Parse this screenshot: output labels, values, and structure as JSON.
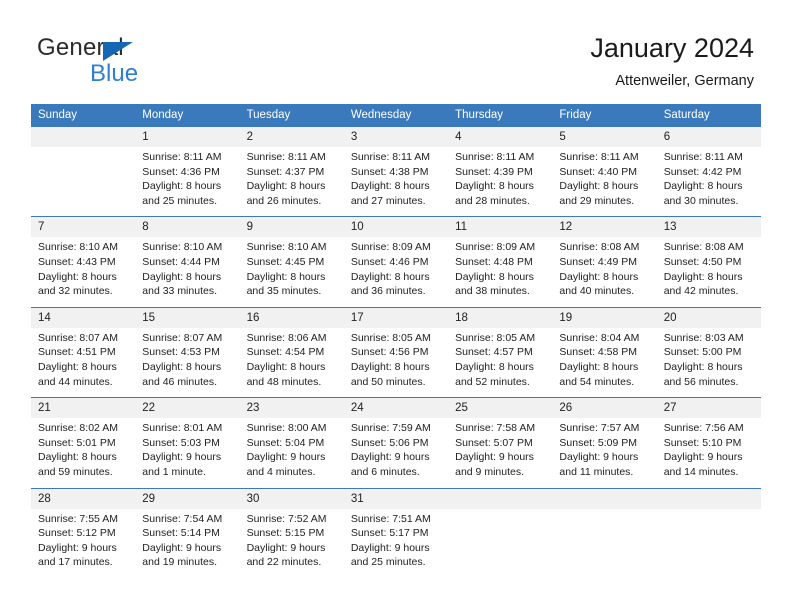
{
  "brand": {
    "name_part1": "General",
    "name_part2": "Blue",
    "accent_color": "#1567b3",
    "blue_text_color": "#2f7fd1"
  },
  "header": {
    "title": "January 2024",
    "subtitle": "Attenweiler, Germany"
  },
  "calendar": {
    "header_bg": "#3b79bd",
    "daynum_bg": "#f1f1f1",
    "weekdays": [
      "Sunday",
      "Monday",
      "Tuesday",
      "Wednesday",
      "Thursday",
      "Friday",
      "Saturday"
    ],
    "weeks": [
      [
        {
          "day": "",
          "sunrise": "",
          "sunset": "",
          "daylight": ""
        },
        {
          "day": "1",
          "sunrise": "Sunrise: 8:11 AM",
          "sunset": "Sunset: 4:36 PM",
          "daylight": "Daylight: 8 hours and 25 minutes."
        },
        {
          "day": "2",
          "sunrise": "Sunrise: 8:11 AM",
          "sunset": "Sunset: 4:37 PM",
          "daylight": "Daylight: 8 hours and 26 minutes."
        },
        {
          "day": "3",
          "sunrise": "Sunrise: 8:11 AM",
          "sunset": "Sunset: 4:38 PM",
          "daylight": "Daylight: 8 hours and 27 minutes."
        },
        {
          "day": "4",
          "sunrise": "Sunrise: 8:11 AM",
          "sunset": "Sunset: 4:39 PM",
          "daylight": "Daylight: 8 hours and 28 minutes."
        },
        {
          "day": "5",
          "sunrise": "Sunrise: 8:11 AM",
          "sunset": "Sunset: 4:40 PM",
          "daylight": "Daylight: 8 hours and 29 minutes."
        },
        {
          "day": "6",
          "sunrise": "Sunrise: 8:11 AM",
          "sunset": "Sunset: 4:42 PM",
          "daylight": "Daylight: 8 hours and 30 minutes."
        }
      ],
      [
        {
          "day": "7",
          "sunrise": "Sunrise: 8:10 AM",
          "sunset": "Sunset: 4:43 PM",
          "daylight": "Daylight: 8 hours and 32 minutes."
        },
        {
          "day": "8",
          "sunrise": "Sunrise: 8:10 AM",
          "sunset": "Sunset: 4:44 PM",
          "daylight": "Daylight: 8 hours and 33 minutes."
        },
        {
          "day": "9",
          "sunrise": "Sunrise: 8:10 AM",
          "sunset": "Sunset: 4:45 PM",
          "daylight": "Daylight: 8 hours and 35 minutes."
        },
        {
          "day": "10",
          "sunrise": "Sunrise: 8:09 AM",
          "sunset": "Sunset: 4:46 PM",
          "daylight": "Daylight: 8 hours and 36 minutes."
        },
        {
          "day": "11",
          "sunrise": "Sunrise: 8:09 AM",
          "sunset": "Sunset: 4:48 PM",
          "daylight": "Daylight: 8 hours and 38 minutes."
        },
        {
          "day": "12",
          "sunrise": "Sunrise: 8:08 AM",
          "sunset": "Sunset: 4:49 PM",
          "daylight": "Daylight: 8 hours and 40 minutes."
        },
        {
          "day": "13",
          "sunrise": "Sunrise: 8:08 AM",
          "sunset": "Sunset: 4:50 PM",
          "daylight": "Daylight: 8 hours and 42 minutes."
        }
      ],
      [
        {
          "day": "14",
          "sunrise": "Sunrise: 8:07 AM",
          "sunset": "Sunset: 4:51 PM",
          "daylight": "Daylight: 8 hours and 44 minutes."
        },
        {
          "day": "15",
          "sunrise": "Sunrise: 8:07 AM",
          "sunset": "Sunset: 4:53 PM",
          "daylight": "Daylight: 8 hours and 46 minutes."
        },
        {
          "day": "16",
          "sunrise": "Sunrise: 8:06 AM",
          "sunset": "Sunset: 4:54 PM",
          "daylight": "Daylight: 8 hours and 48 minutes."
        },
        {
          "day": "17",
          "sunrise": "Sunrise: 8:05 AM",
          "sunset": "Sunset: 4:56 PM",
          "daylight": "Daylight: 8 hours and 50 minutes."
        },
        {
          "day": "18",
          "sunrise": "Sunrise: 8:05 AM",
          "sunset": "Sunset: 4:57 PM",
          "daylight": "Daylight: 8 hours and 52 minutes."
        },
        {
          "day": "19",
          "sunrise": "Sunrise: 8:04 AM",
          "sunset": "Sunset: 4:58 PM",
          "daylight": "Daylight: 8 hours and 54 minutes."
        },
        {
          "day": "20",
          "sunrise": "Sunrise: 8:03 AM",
          "sunset": "Sunset: 5:00 PM",
          "daylight": "Daylight: 8 hours and 56 minutes."
        }
      ],
      [
        {
          "day": "21",
          "sunrise": "Sunrise: 8:02 AM",
          "sunset": "Sunset: 5:01 PM",
          "daylight": "Daylight: 8 hours and 59 minutes."
        },
        {
          "day": "22",
          "sunrise": "Sunrise: 8:01 AM",
          "sunset": "Sunset: 5:03 PM",
          "daylight": "Daylight: 9 hours and 1 minute."
        },
        {
          "day": "23",
          "sunrise": "Sunrise: 8:00 AM",
          "sunset": "Sunset: 5:04 PM",
          "daylight": "Daylight: 9 hours and 4 minutes."
        },
        {
          "day": "24",
          "sunrise": "Sunrise: 7:59 AM",
          "sunset": "Sunset: 5:06 PM",
          "daylight": "Daylight: 9 hours and 6 minutes."
        },
        {
          "day": "25",
          "sunrise": "Sunrise: 7:58 AM",
          "sunset": "Sunset: 5:07 PM",
          "daylight": "Daylight: 9 hours and 9 minutes."
        },
        {
          "day": "26",
          "sunrise": "Sunrise: 7:57 AM",
          "sunset": "Sunset: 5:09 PM",
          "daylight": "Daylight: 9 hours and 11 minutes."
        },
        {
          "day": "27",
          "sunrise": "Sunrise: 7:56 AM",
          "sunset": "Sunset: 5:10 PM",
          "daylight": "Daylight: 9 hours and 14 minutes."
        }
      ],
      [
        {
          "day": "28",
          "sunrise": "Sunrise: 7:55 AM",
          "sunset": "Sunset: 5:12 PM",
          "daylight": "Daylight: 9 hours and 17 minutes."
        },
        {
          "day": "29",
          "sunrise": "Sunrise: 7:54 AM",
          "sunset": "Sunset: 5:14 PM",
          "daylight": "Daylight: 9 hours and 19 minutes."
        },
        {
          "day": "30",
          "sunrise": "Sunrise: 7:52 AM",
          "sunset": "Sunset: 5:15 PM",
          "daylight": "Daylight: 9 hours and 22 minutes."
        },
        {
          "day": "31",
          "sunrise": "Sunrise: 7:51 AM",
          "sunset": "Sunset: 5:17 PM",
          "daylight": "Daylight: 9 hours and 25 minutes."
        },
        {
          "day": "",
          "sunrise": "",
          "sunset": "",
          "daylight": ""
        },
        {
          "day": "",
          "sunrise": "",
          "sunset": "",
          "daylight": ""
        },
        {
          "day": "",
          "sunrise": "",
          "sunset": "",
          "daylight": ""
        }
      ]
    ]
  }
}
